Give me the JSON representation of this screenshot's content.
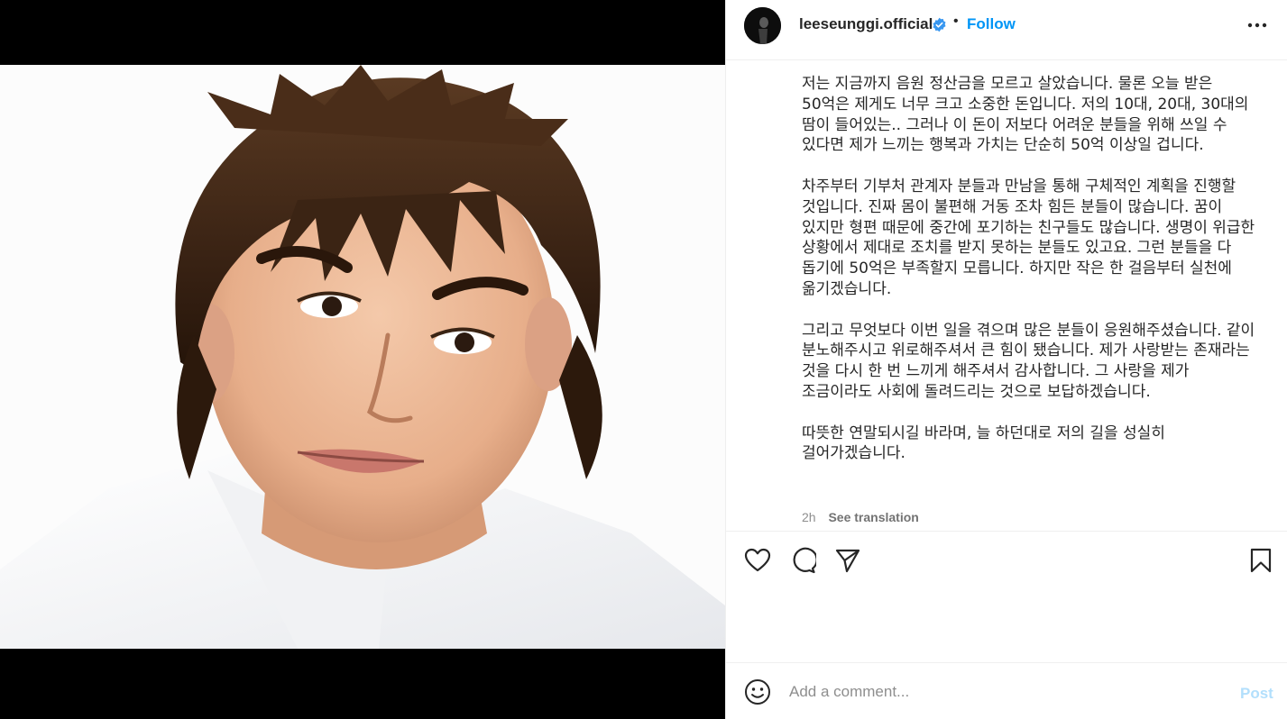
{
  "post": {
    "username": "leeseunggi.official",
    "verified": true,
    "separator": "•",
    "follow_label": "Follow",
    "more_icon": "more-horizontal-icon"
  },
  "caption": {
    "paragraphs": [
      "저는 지금까지 음원 정산금을 모르고 살았습니다. 물론 오늘 받은 50억은 제게도 너무 크고 소중한 돈입니다. 저의 10대, 20대, 30대의 땀이 들어있는.. 그러나 이 돈이 저보다 어려운 분들을 위해 쓰일 수 있다면 제가 느끼는 행복과 가치는 단순히 50억 이상일 겁니다.",
      "차주부터 기부처 관계자 분들과 만남을 통해 구체적인 계획을 진행할 것입니다. 진짜 몸이 불편해 거동 조차 힘든 분들이 많습니다. 꿈이 있지만 형편 때문에 중간에 포기하는 친구들도 많습니다. 생명이 위급한 상황에서 제대로 조치를 받지 못하는 분들도 있고요. 그런 분들을 다 돕기에 50억은 부족할지 모릅니다. 하지만 작은 한 걸음부터 실천에 옮기겠습니다.",
      "그리고 무엇보다 이번 일을 겪으며 많은 분들이 응원해주셨습니다. 같이 분노해주시고 위로해주셔서 큰 힘이 됐습니다. 제가 사랑받는 존재라는 것을 다시 한 번 느끼게 해주셔서 감사합니다. 그 사랑을 제가 조금이라도 사회에 돌려드리는 것으로 보답하겠습니다.",
      "따뜻한 연말되시길 바라며, 늘 하던대로 저의 길을 성실히 걸어가겠습니다."
    ]
  },
  "meta": {
    "time": "2h",
    "see_translation": "See translation"
  },
  "actions": {
    "like_icon": "heart-icon",
    "comment_icon": "comment-icon",
    "share_icon": "paper-plane-icon",
    "save_icon": "bookmark-icon"
  },
  "comment_bar": {
    "emoji_icon": "smiley-icon",
    "placeholder": "Add a comment...",
    "post_label": "Post"
  },
  "colors": {
    "accent": "#0095f6",
    "post_disabled": "#b2dffc",
    "verified": "#3897f0"
  }
}
